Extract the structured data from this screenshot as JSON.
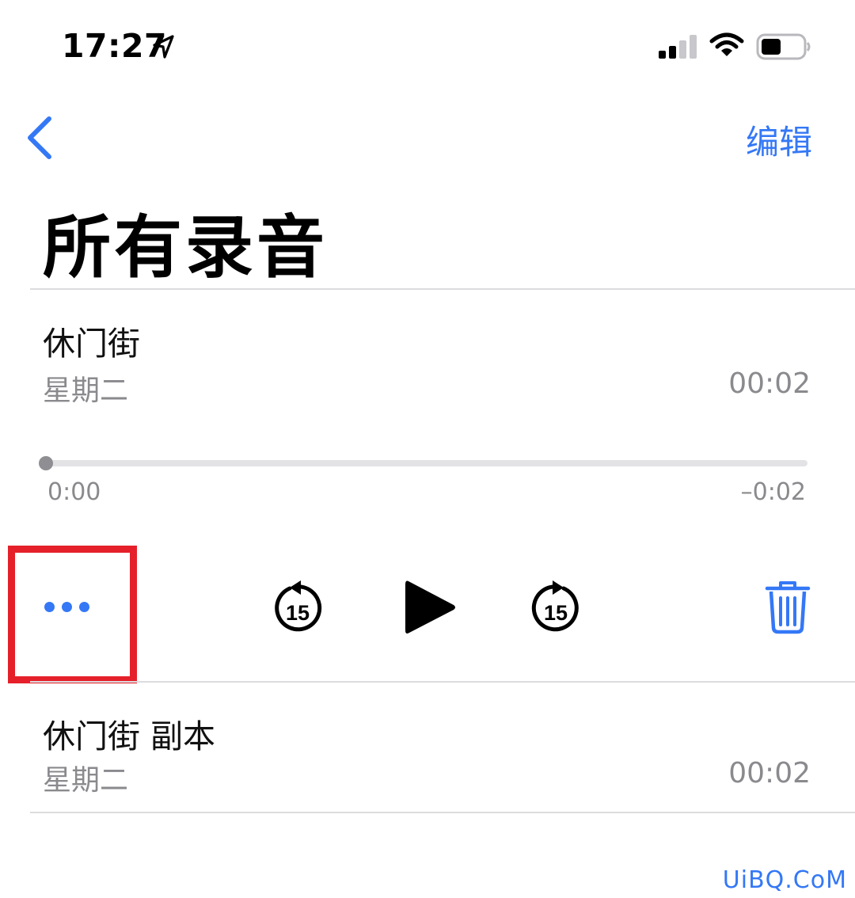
{
  "status_bar": {
    "time": "17:27",
    "icons": [
      "location-arrow-icon",
      "cellular-signal-icon",
      "wifi-icon",
      "battery-icon"
    ]
  },
  "nav": {
    "back_icon": "chevron-left-icon",
    "edit_label": "编辑"
  },
  "page_title": "所有录音",
  "recordings": [
    {
      "title": "休门街",
      "date": "星期二",
      "duration": "00:02",
      "expanded": true,
      "player": {
        "elapsed": "0:00",
        "remaining": "–0:02",
        "progress": 0,
        "controls": [
          "more-options-icon",
          "skip-back-15-icon",
          "play-icon",
          "skip-forward-15-icon",
          "trash-icon"
        ],
        "skip_seconds": "15"
      }
    },
    {
      "title": "休门街 副本",
      "date": "星期二",
      "duration": "00:02",
      "expanded": false
    }
  ],
  "watermark": "UiBQ.CoM",
  "colors": {
    "accent": "#3478f6",
    "highlight": "#e5202a",
    "secondary_text": "#8a8a8e"
  }
}
